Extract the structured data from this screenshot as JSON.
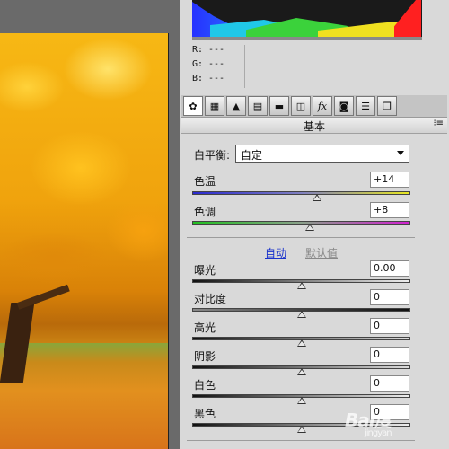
{
  "readout": {
    "r_label": "R:",
    "r_value": "---",
    "g_label": "G:",
    "g_value": "---",
    "b_label": "B:",
    "b_value": "---"
  },
  "tabs": [
    {
      "icon": "aperture-icon",
      "glyph": "✿"
    },
    {
      "icon": "tone-curve-icon",
      "glyph": "▦"
    },
    {
      "icon": "detail-icon",
      "glyph": "▲"
    },
    {
      "icon": "hsl-icon",
      "glyph": "▤"
    },
    {
      "icon": "split-toning-icon",
      "glyph": "▬"
    },
    {
      "icon": "lens-icon",
      "glyph": "◫"
    },
    {
      "icon": "fx-icon",
      "glyph": "fx"
    },
    {
      "icon": "camera-icon",
      "glyph": "◙"
    },
    {
      "icon": "presets-icon",
      "glyph": "☰"
    },
    {
      "icon": "snapshots-icon",
      "glyph": "❐"
    }
  ],
  "panel": {
    "title": "基本",
    "menu_icon": "⁝≡"
  },
  "white_balance": {
    "label": "白平衡:",
    "value": "自定"
  },
  "sliders": {
    "temperature": {
      "label": "色温",
      "value": "+14",
      "level": 0.57
    },
    "tint": {
      "label": "色调",
      "value": "+8",
      "level": 0.54
    },
    "exposure": {
      "label": "曝光",
      "value": "0.00",
      "level": 0.5
    },
    "contrast": {
      "label": "对比度",
      "value": "0",
      "level": 0.5
    },
    "highlights": {
      "label": "高光",
      "value": "0",
      "level": 0.5
    },
    "shadows": {
      "label": "阴影",
      "value": "0",
      "level": 0.5
    },
    "whites": {
      "label": "白色",
      "value": "0",
      "level": 0.5
    },
    "blacks": {
      "label": "黑色",
      "value": "0",
      "level": 0.5
    }
  },
  "links": {
    "auto": "自动",
    "default": "默认值"
  },
  "watermark": {
    "text": "Bai度",
    "sub": "jingyan"
  },
  "colors": {
    "panel_bg": "#d9d9d9",
    "link": "#1a33cc",
    "temp_left": "#2a2ad0",
    "temp_right": "#e8e820",
    "tint_left": "#22c022",
    "tint_right": "#d020d0"
  }
}
